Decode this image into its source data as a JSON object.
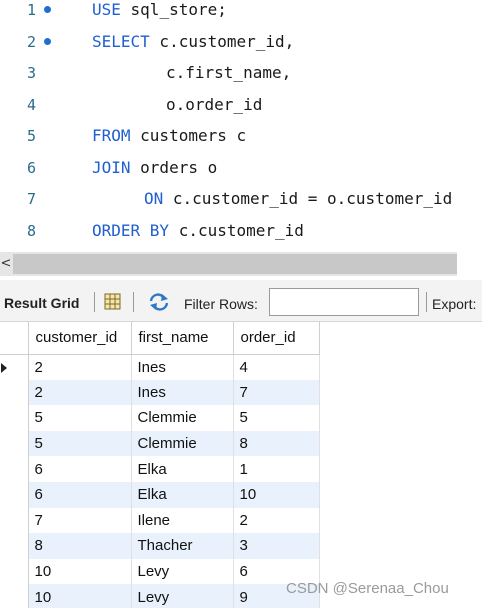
{
  "editor": {
    "lines": [
      {
        "number": "1",
        "dot": true,
        "keyword": "USE",
        "text": " sql_store;",
        "indent": 0
      },
      {
        "number": "2",
        "dot": true,
        "keyword": "SELECT",
        "text": " c.customer_id,",
        "indent": 0
      },
      {
        "number": "3",
        "dot": false,
        "keyword": "",
        "text": "c.first_name,",
        "indent": 1
      },
      {
        "number": "4",
        "dot": false,
        "keyword": "",
        "text": "o.order_id",
        "indent": 1
      },
      {
        "number": "5",
        "dot": false,
        "keyword": "FROM",
        "text": " customers c",
        "indent": 0
      },
      {
        "number": "6",
        "dot": false,
        "keyword": "JOIN",
        "text": " orders o",
        "indent": 0
      },
      {
        "number": "7",
        "dot": false,
        "keyword": "ON",
        "text": " c.customer_id = o.customer_id",
        "indent": 2
      },
      {
        "number": "8",
        "dot": false,
        "keyword": "ORDER BY",
        "text": " c.customer_id",
        "indent": 0
      }
    ]
  },
  "scrollbar": {
    "left_arrow": "<"
  },
  "toolbar": {
    "result_grid_label": "Result Grid",
    "filter_label": "Filter Rows:",
    "filter_value": "",
    "export_label": "Export:"
  },
  "grid": {
    "columns": [
      "customer_id",
      "first_name",
      "order_id"
    ],
    "rows": [
      [
        "2",
        "Ines",
        "4"
      ],
      [
        "2",
        "Ines",
        "7"
      ],
      [
        "5",
        "Clemmie",
        "5"
      ],
      [
        "5",
        "Clemmie",
        "8"
      ],
      [
        "6",
        "Elka",
        "1"
      ],
      [
        "6",
        "Elka",
        "10"
      ],
      [
        "7",
        "Ilene",
        "2"
      ],
      [
        "8",
        "Thacher",
        "3"
      ],
      [
        "10",
        "Levy",
        "6"
      ],
      [
        "10",
        "Levy",
        "9"
      ]
    ],
    "selected_row": 0
  },
  "watermark": "CSDN @Serenaa_Chou"
}
